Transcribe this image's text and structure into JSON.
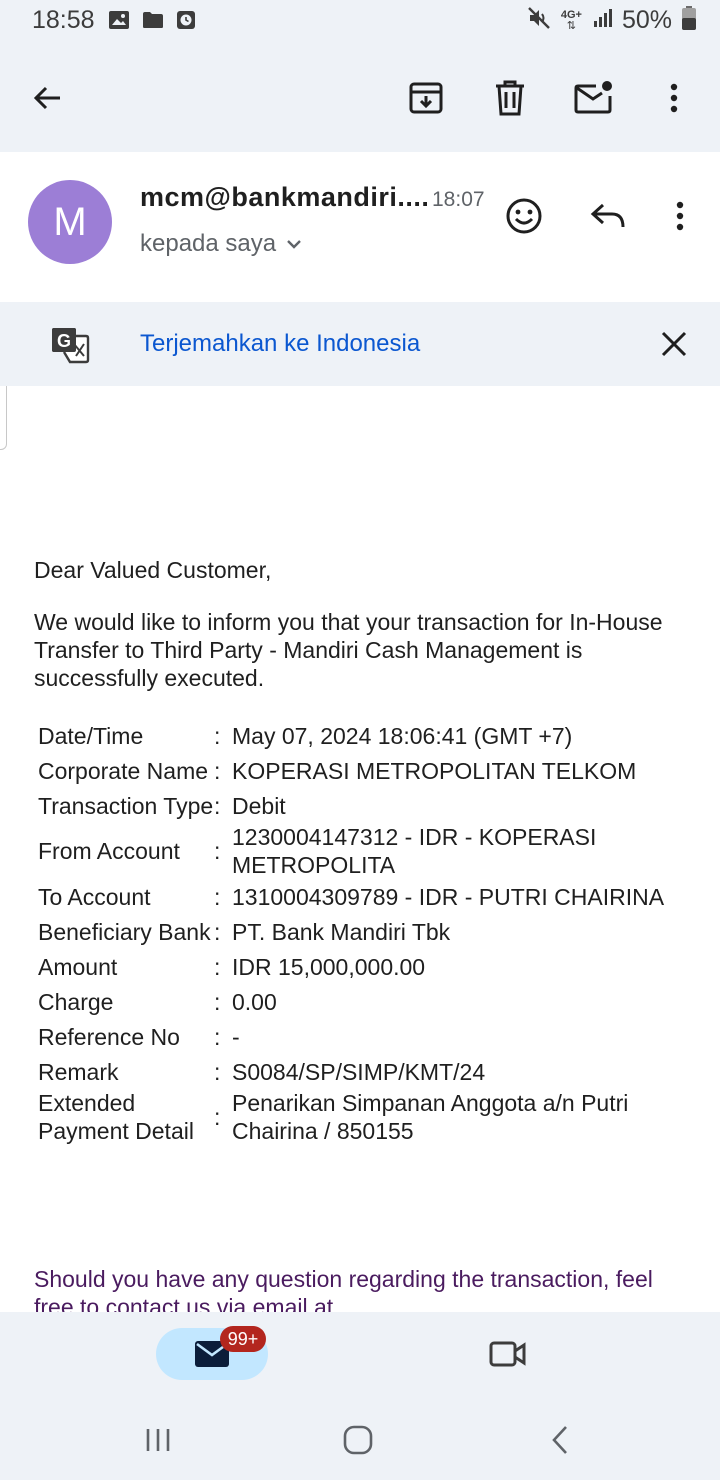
{
  "status_bar": {
    "time": "18:58",
    "network": "4G+",
    "battery": "50%",
    "left_icons": [
      "image-icon",
      "folder-icon",
      "clock-app-icon"
    ],
    "right_icons": [
      "mute-icon",
      "network-4g-icon",
      "signal-icon",
      "battery-icon"
    ]
  },
  "toolbar": {
    "icons": [
      "back-arrow-icon",
      "archive-icon",
      "delete-icon",
      "mark-unread-icon",
      "more-vert-icon"
    ]
  },
  "email": {
    "avatar_letter": "M",
    "avatar_color": "#9c7ed6",
    "sender": "mcm@bankmandiri....",
    "time": "18:07",
    "recipient": "kepada saya",
    "icons": [
      "emoji-icon",
      "reply-icon",
      "more-vert-icon"
    ]
  },
  "translate": {
    "label": "Terjemahkan ke Indonesia",
    "link_color": "#0b57d0"
  },
  "body": {
    "greeting": "Dear Valued Customer,",
    "intro": "We would like to inform you that your transaction for In-House Transfer to Third Party - Mandiri Cash Management is successfully executed.",
    "details": [
      {
        "label": "Date/Time",
        "value": "May 07, 2024 18:06:41 (GMT +7)"
      },
      {
        "label": "Corporate Name",
        "value": "KOPERASI METROPOLITAN TELKOM"
      },
      {
        "label": "Transaction Type",
        "value": "Debit"
      },
      {
        "label": "From Account",
        "value": "1230004147312 - IDR - KOPERASI METROPOLITA"
      },
      {
        "label": "To Account",
        "value": "1310004309789 - IDR - PUTRI CHAIRINA"
      },
      {
        "label": "Beneficiary Bank",
        "value": "PT. Bank Mandiri Tbk"
      },
      {
        "label": "Amount",
        "value": "IDR 15,000,000.00"
      },
      {
        "label": "Charge",
        "value": "0.00"
      },
      {
        "label": "Reference No",
        "value": "-"
      },
      {
        "label": "Remark",
        "value": "S0084/SP/SIMP/KMT/24"
      },
      {
        "label": "Extended Payment Detail",
        "value": "Penarikan Simpanan Anggota a/n Putri Chairina / 850155"
      }
    ],
    "separator": ":",
    "footer": "Should you have any question regarding the transaction, feel free to contact us via email at"
  },
  "bottom_nav": {
    "mail_badge": "99+",
    "icons": [
      "mail-icon",
      "video-icon"
    ],
    "active_color": "#c2e7ff"
  },
  "system_nav": {
    "icons": [
      "recents-icon",
      "home-icon",
      "back-icon"
    ]
  }
}
